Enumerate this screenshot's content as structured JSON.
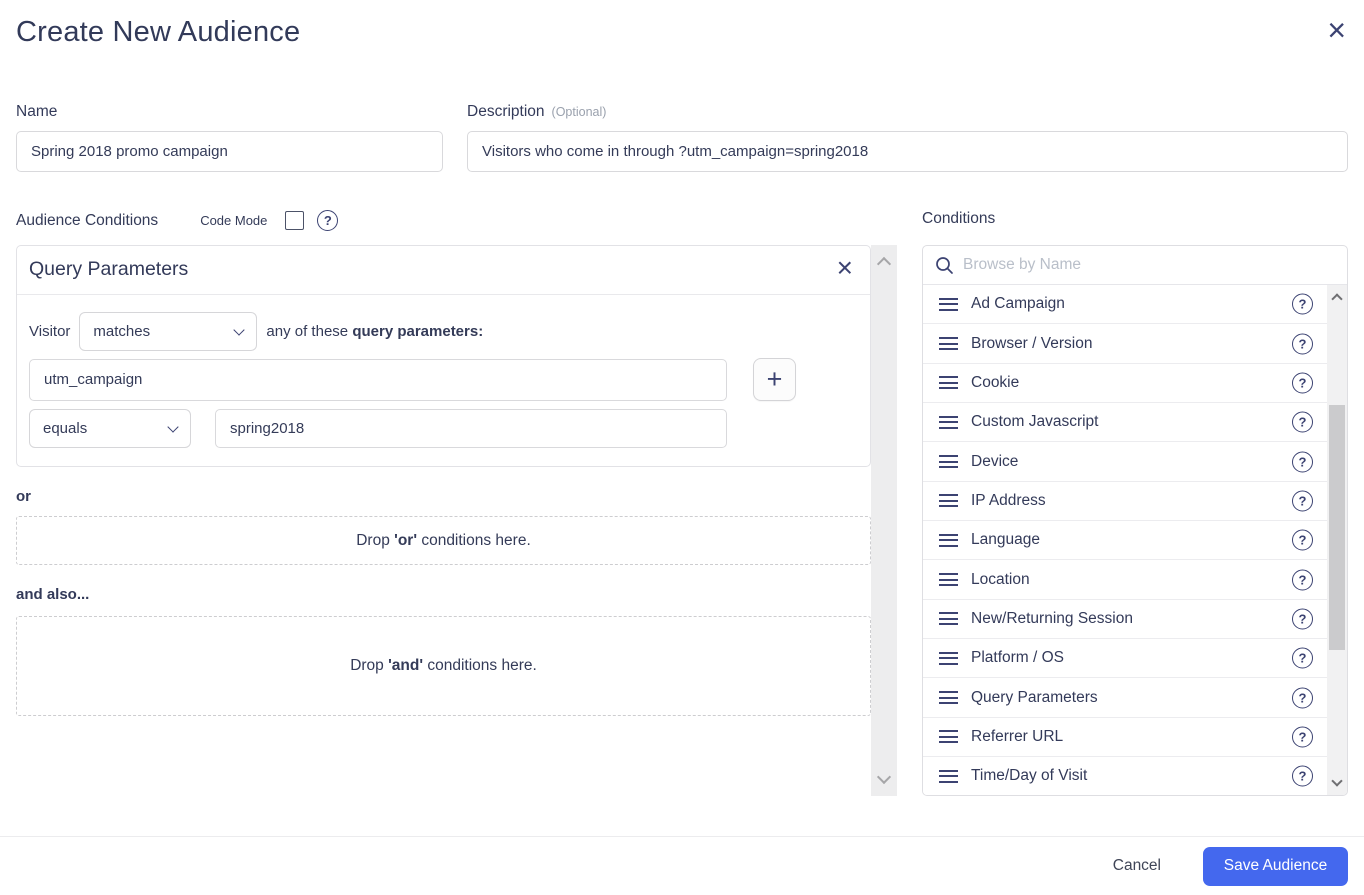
{
  "colors": {
    "accent": "#4468ee",
    "ink": "#343b58"
  },
  "icons": {
    "help": "?",
    "close": "×",
    "add": "+"
  },
  "modal": {
    "title": "Create New Audience"
  },
  "form": {
    "name": {
      "label": "Name",
      "value": "Spring 2018 promo campaign"
    },
    "description": {
      "label": "Description",
      "optional_hint": "(Optional)",
      "value": "Visitors who come in through ?utm_campaign=spring2018"
    }
  },
  "audience_conditions": {
    "heading": "Audience Conditions",
    "code_mode_label": "Code Mode",
    "code_mode_checked": false,
    "card": {
      "title": "Query Parameters",
      "visitor_label": "Visitor",
      "match_value": "matches",
      "suffix_pre": "any of these ",
      "suffix_bold": "query parameters:",
      "param_key": "utm_campaign",
      "operator_value": "equals",
      "param_value": "spring2018"
    },
    "or_heading": "or",
    "or_drop": {
      "pre": "Drop ",
      "bold": "'or'",
      "post": " conditions here."
    },
    "and_heading": "and also...",
    "and_drop": {
      "pre": "Drop ",
      "bold": "'and'",
      "post": " conditions here."
    }
  },
  "conditions_panel": {
    "heading": "Conditions",
    "search_placeholder": "Browse by Name",
    "items": [
      {
        "label": "Ad Campaign"
      },
      {
        "label": "Browser / Version"
      },
      {
        "label": "Cookie"
      },
      {
        "label": "Custom Javascript"
      },
      {
        "label": "Device"
      },
      {
        "label": "IP Address"
      },
      {
        "label": "Language"
      },
      {
        "label": "Location"
      },
      {
        "label": "New/Returning Session"
      },
      {
        "label": "Platform / OS"
      },
      {
        "label": "Query Parameters"
      },
      {
        "label": "Referrer URL"
      },
      {
        "label": "Time/Day of Visit"
      }
    ]
  },
  "footer": {
    "cancel": "Cancel",
    "save": "Save Audience"
  }
}
